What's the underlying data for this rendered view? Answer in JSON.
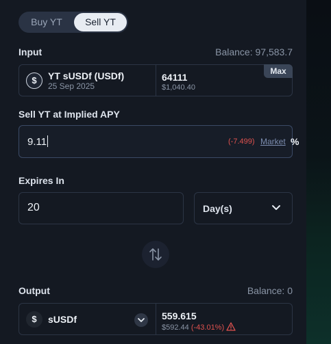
{
  "tabs": {
    "buy_label": "Buy YT",
    "sell_label": "Sell YT"
  },
  "input": {
    "label": "Input",
    "balance": "Balance: 97,583.7",
    "token_symbol_icon": "$",
    "token_name": "YT sUSDf (USDf)",
    "token_date": "25 Sep 2025",
    "amount": "64111",
    "usd_value": "$1,040.40",
    "max_label": "Max"
  },
  "apy": {
    "label": "Sell YT at Implied APY",
    "value": "9.11",
    "diff": "(-7.499)",
    "market_label": "Market",
    "unit": "%"
  },
  "expires": {
    "label": "Expires In",
    "value": "20",
    "unit": "Day(s)"
  },
  "output": {
    "label": "Output",
    "balance": "Balance: 0",
    "token_symbol_icon": "$",
    "token_name": "sUSDf",
    "amount": "559.615",
    "usd_value": "$592.44",
    "change": "(-43.01%)"
  },
  "icons": {
    "swap": "swap-arrows-icon",
    "chevron": "chevron-down-icon",
    "warning": "warning-triangle-icon"
  },
  "colors": {
    "negative": "#e0524f",
    "active_tab": "#e8ecf2",
    "market_link": "#7c8db0"
  }
}
